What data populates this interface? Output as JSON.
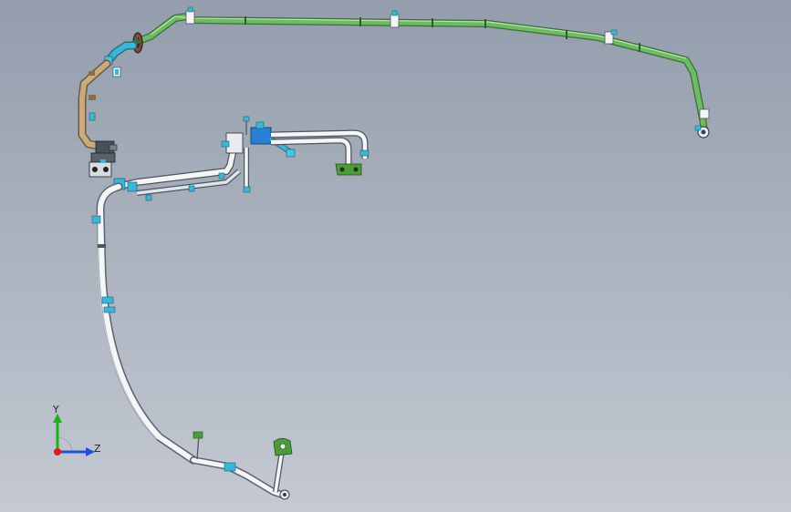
{
  "viewport": {
    "background_top": "#939dac",
    "background_bottom": "#c4c9d2"
  },
  "colors": {
    "pipe_green": "#6dbb62",
    "pipe_green_dark": "#2f7d2f",
    "pipe_white": "#f4f6f8",
    "pipe_outline": "#4d5560",
    "fitting_cyan": "#3bb6d6",
    "fitting_blue": "#2a7fd8",
    "hose_tan": "#c8ab7e",
    "bracket_green": "#4e9b3e",
    "flange_brown": "#7a4d3c"
  },
  "triad": {
    "y_label": "Y",
    "z_label": "Z",
    "y_color": "#19b219",
    "z_color": "#1f52d9",
    "x_color": "#d81e1e"
  }
}
